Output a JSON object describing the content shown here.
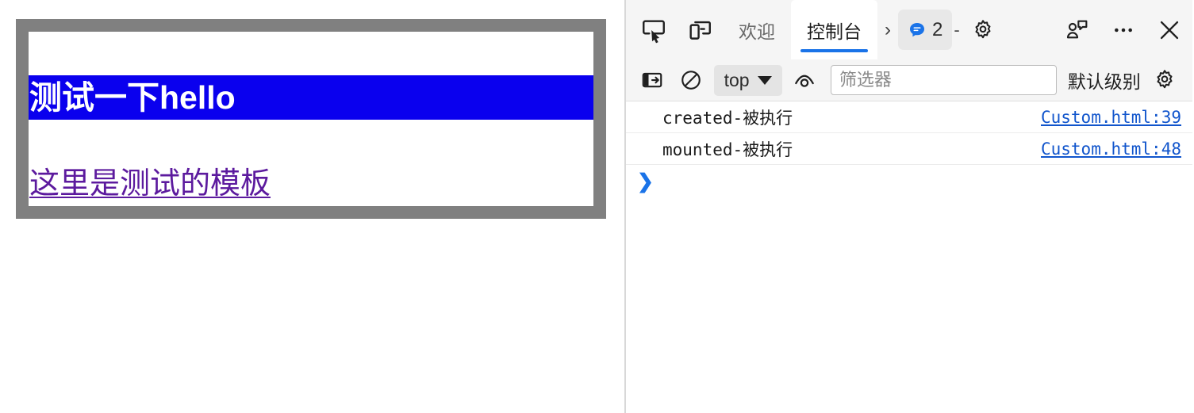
{
  "page": {
    "heading": "测试一下hello",
    "link_text": "这里是测试的模板",
    "highlight_color": "#0a00ee",
    "link_color": "#5c1a9e",
    "border_color": "#808080"
  },
  "devtools": {
    "toolbar": {
      "inspect_icon": "inspect-element-icon",
      "device_icon": "device-toolbar-icon",
      "more_tabs_chevron": "›",
      "message_count": "2",
      "message_separator": "-",
      "settings_icon": "gear-icon",
      "feedback_icon": "feedback-icon",
      "more_icon": "more-options-icon",
      "close_icon": "close-icon"
    },
    "tabs": [
      {
        "label": "欢迎",
        "active": false
      },
      {
        "label": "控制台",
        "active": true
      }
    ],
    "filterbar": {
      "sidebar_icon": "console-sidebar-icon",
      "clear_icon": "clear-console-icon",
      "context": "top",
      "eye_icon": "live-expression-icon",
      "filter_value": "",
      "filter_placeholder": "筛选器",
      "levels_label": "默认级别",
      "settings_icon": "console-settings-icon"
    },
    "console": {
      "entries": [
        {
          "message": "created-被执行",
          "source": "Custom.html:39"
        },
        {
          "message": "mounted-被执行",
          "source": "Custom.html:48"
        }
      ],
      "prompt": "❯"
    }
  }
}
